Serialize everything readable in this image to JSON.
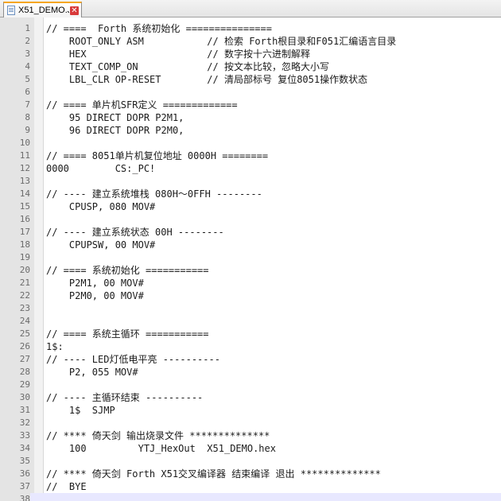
{
  "tab": {
    "title": "X51_DEMO.J"
  },
  "editor": {
    "current_line": 38,
    "lines": [
      {
        "n": "1",
        "text": "// ====  Forth 系统初始化 ==============="
      },
      {
        "n": "2",
        "text": "    ROOT_ONLY ASM           // 检索 Forth根目录和F051汇编语言目录"
      },
      {
        "n": "3",
        "text": "    HEX                     // 数字按十六进制解释"
      },
      {
        "n": "4",
        "text": "    TEXT_COMP_ON            // 按文本比较，忽略大小写"
      },
      {
        "n": "5",
        "text": "    LBL_CLR OP-RESET        // 清局部标号 复位8051操作数状态"
      },
      {
        "n": "6",
        "text": ""
      },
      {
        "n": "7",
        "text": "// ==== 单片机SFR定义 ============="
      },
      {
        "n": "8",
        "text": "    95 DIRECT DOPR P2M1,"
      },
      {
        "n": "9",
        "text": "    96 DIRECT DOPR P2M0,"
      },
      {
        "n": "10",
        "text": ""
      },
      {
        "n": "11",
        "text": "// ==== 8051单片机复位地址 0000H ========"
      },
      {
        "n": "12",
        "text": "0000        CS:_PC!"
      },
      {
        "n": "13",
        "text": ""
      },
      {
        "n": "14",
        "text": "// ---- 建立系统堆栈 080H～0FFH --------"
      },
      {
        "n": "15",
        "text": "    CPUSP, 080 MOV#"
      },
      {
        "n": "16",
        "text": ""
      },
      {
        "n": "17",
        "text": "// ---- 建立系统状态 00H --------"
      },
      {
        "n": "18",
        "text": "    CPUPSW, 00 MOV#"
      },
      {
        "n": "19",
        "text": ""
      },
      {
        "n": "20",
        "text": "// ==== 系统初始化 ==========="
      },
      {
        "n": "21",
        "text": "    P2M1, 00 MOV#"
      },
      {
        "n": "22",
        "text": "    P2M0, 00 MOV#"
      },
      {
        "n": "23",
        "text": ""
      },
      {
        "n": "24",
        "text": ""
      },
      {
        "n": "25",
        "text": "// ==== 系统主循环 ==========="
      },
      {
        "n": "26",
        "text": "1$:"
      },
      {
        "n": "27",
        "text": "// ---- LED灯低电平亮 ----------"
      },
      {
        "n": "28",
        "text": "    P2, 055 MOV#"
      },
      {
        "n": "29",
        "text": ""
      },
      {
        "n": "30",
        "text": "// ---- 主循环结束 ----------"
      },
      {
        "n": "31",
        "text": "    1$  SJMP"
      },
      {
        "n": "32",
        "text": ""
      },
      {
        "n": "33",
        "text": "// **** 倚天剑 输出烧录文件 **************"
      },
      {
        "n": "34",
        "text": "    100         YTJ_HexOut  X51_DEMO.hex"
      },
      {
        "n": "35",
        "text": ""
      },
      {
        "n": "36",
        "text": "// **** 倚天剑 Forth X51交叉编译器 结束编译 退出 **************"
      },
      {
        "n": "37",
        "text": "//  BYE"
      },
      {
        "n": "38",
        "text": ""
      }
    ]
  }
}
